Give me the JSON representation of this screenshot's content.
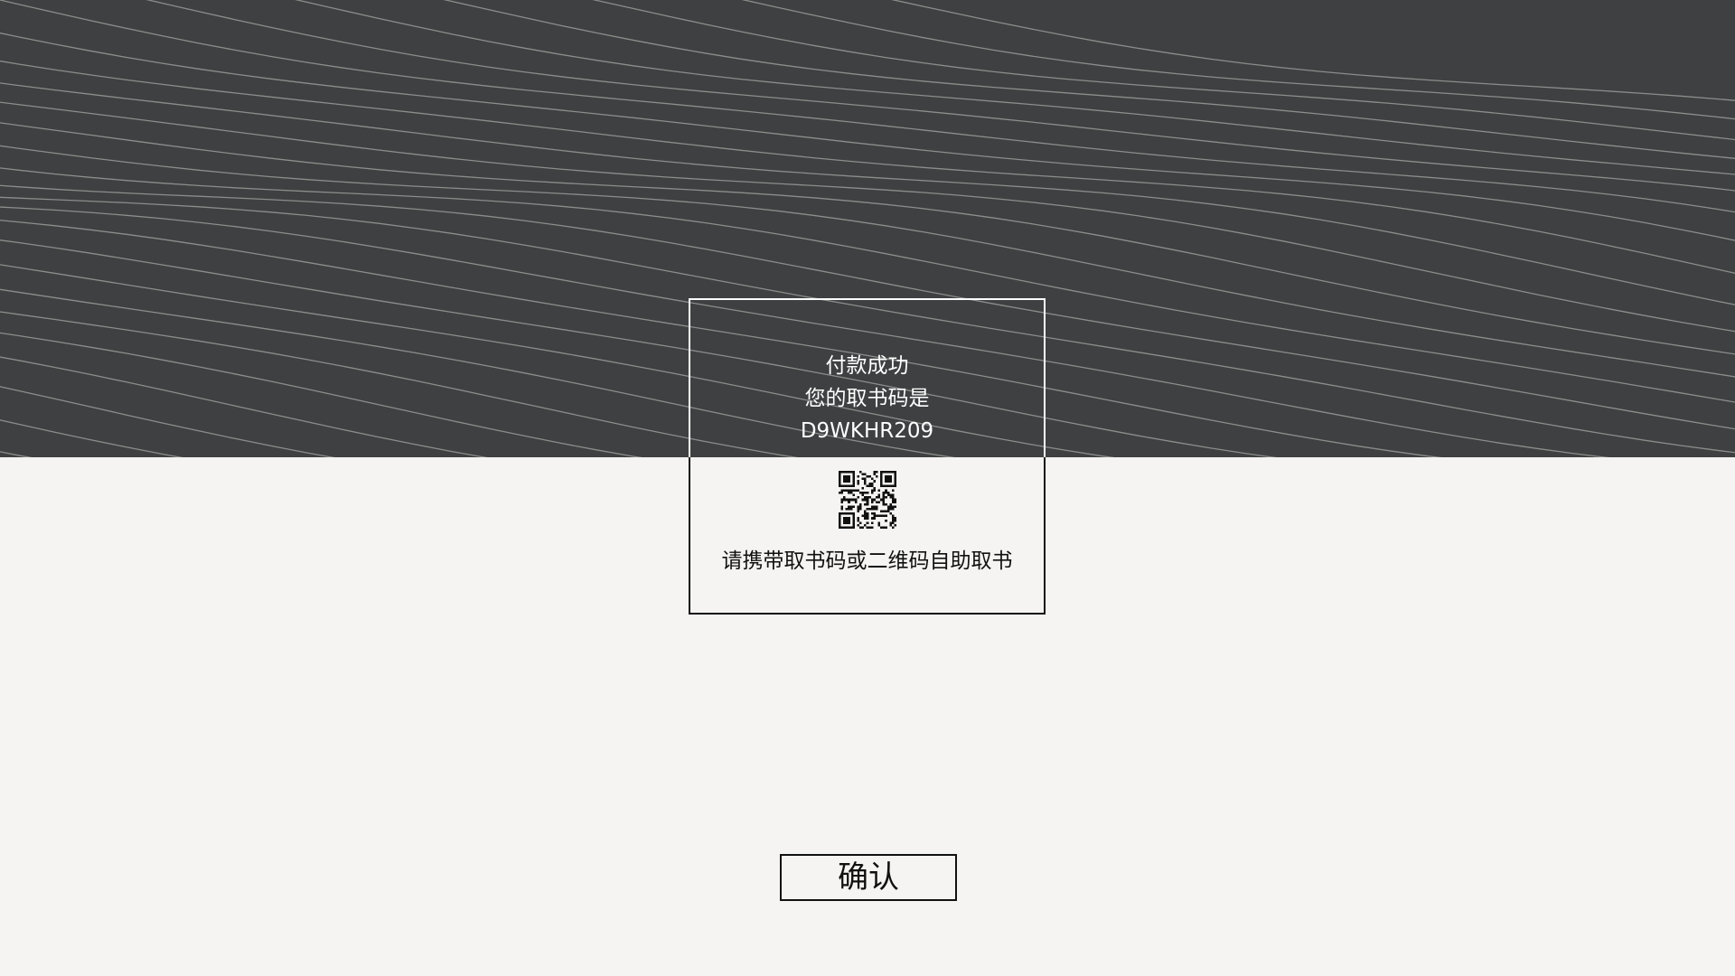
{
  "card": {
    "title": "付款成功",
    "code_label": "您的取书码是",
    "pickup_code": "D9WKHR209",
    "hint": "请携带取书码或二维码自助取书"
  },
  "actions": {
    "confirm_label": "确认"
  },
  "colors": {
    "hero_bg": "#3e4041",
    "page_bg": "#f5f4f2",
    "text_dark": "#111111",
    "text_light": "#ffffff"
  },
  "icons": {
    "qr": "qr-code-icon"
  }
}
